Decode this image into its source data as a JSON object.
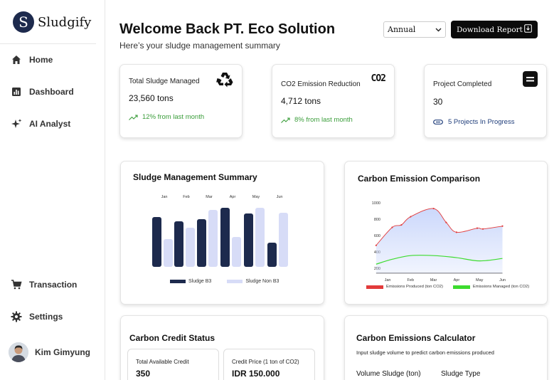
{
  "brand": {
    "mark": "S",
    "name": "Sludgify"
  },
  "nav": {
    "home": "Home",
    "dashboard": "Dashboard",
    "ai_analyst": "AI Analyst",
    "transaction": "Transaction",
    "settings": "Settings"
  },
  "user": {
    "name": "Kim Gimyung"
  },
  "header": {
    "welcome": "Welcome Back PT. Eco Solution",
    "subtitle": "Here’s your sludge management summary",
    "period_select": "Annual",
    "download_label": "Download Report"
  },
  "stats": {
    "total_sludge": {
      "title": "Total Sludge Managed",
      "value": "23,560 tons",
      "trend": "12% from last month"
    },
    "co2": {
      "title": "CO2 Emission Reduction",
      "value": "4,712 tons",
      "trend": "8% from last month",
      "icon_text": "CO2"
    },
    "projects": {
      "title": "Project Completed",
      "value": "30",
      "progress": "5 Projects In Progress"
    }
  },
  "sludge_summary": {
    "title": "Sludge Management Summary",
    "legend_b3": "Sludge B3",
    "legend_non_b3": "Sludge Non B3"
  },
  "carbon_comparison": {
    "title": "Carbon Emission Comparison",
    "legend_produced": "Emissions Produced (ton CO2)",
    "legend_managed": "Emissions Managed (ton CO2)"
  },
  "carbon_credit": {
    "title": "Carbon Credit Status",
    "available_label": "Total Available Credit",
    "available_value": "350",
    "price_label": "Credit Price (1 ton of CO2)",
    "price_value": "IDR 150.000"
  },
  "calculator": {
    "title": "Carbon Emissions Calculator",
    "description": "Input sludge volume to predict carbon emissions produced",
    "volume_label": "Volume Sludge (ton)",
    "type_label": "Sludge Type"
  },
  "colors": {
    "dark_bar": "#1d2a4d",
    "light_bar": "#d7dcf7",
    "produced": "#e23b3b",
    "managed": "#3ddc2f",
    "area_fill": "#c9d6fb",
    "trend_green": "#3a9d3a"
  },
  "chart_data": [
    {
      "type": "bar",
      "title": "Sludge Management Summary",
      "categories": [
        "Jan",
        "Feb",
        "Mar",
        "Apr",
        "May",
        "Jun"
      ],
      "series": [
        {
          "name": "Sludge B3",
          "values": [
            70,
            64,
            67,
            83,
            75,
            34
          ]
        },
        {
          "name": "Sludge Non B3",
          "values": [
            39,
            55,
            80,
            42,
            83,
            76
          ]
        }
      ],
      "legend_position": "bottom",
      "grid": false
    },
    {
      "type": "area",
      "title": "Carbon Emission Comparison",
      "categories": [
        "Jan",
        "Feb",
        "Mar",
        "Apr",
        "May",
        "Jun"
      ],
      "series": [
        {
          "name": "Emissions Produced (ton CO2)",
          "x": [
            0.5,
            1.2,
            1.6,
            2.0,
            3.0,
            3.55,
            4.0,
            4.9,
            5.15,
            6.0
          ],
          "values": [
            480,
            700,
            730,
            830,
            930,
            760,
            640,
            690,
            680,
            715
          ]
        },
        {
          "name": "Emissions Managed (ton CO2)",
          "x": [
            0.5,
            1.2,
            2.0,
            3.0,
            4.0,
            5.0,
            6.0
          ],
          "values": [
            250,
            310,
            355,
            355,
            330,
            290,
            320
          ]
        }
      ],
      "yticks": [
        200,
        400,
        600,
        800,
        1000
      ],
      "ylim": [
        140,
        1000
      ],
      "legend_position": "bottom",
      "grid": false
    }
  ]
}
